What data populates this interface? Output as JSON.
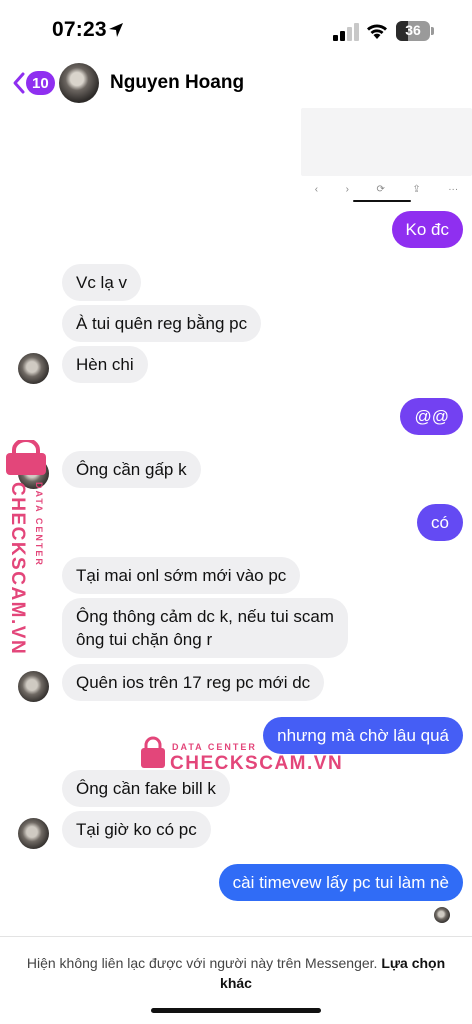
{
  "status_bar": {
    "time": "07:23",
    "battery_text": "36",
    "battery_level_percent": 36,
    "icons": [
      "location-arrow-icon",
      "cellular-signal-icon",
      "wifi-icon",
      "battery-icon"
    ]
  },
  "header": {
    "back_count": "10",
    "contact_name": "Nguyen Hoang",
    "icons": [
      "chevron-left-icon",
      "avatar"
    ]
  },
  "preview": {
    "toolbar_glyphs": [
      "‹",
      "›",
      "⟳",
      "⇪",
      "···"
    ]
  },
  "messages": [
    {
      "side": "out",
      "text": "Ko đc"
    },
    {
      "side": "in",
      "text": "Vc lạ v"
    },
    {
      "side": "in",
      "text": "À tui quên reg bằng pc"
    },
    {
      "side": "in",
      "text": "Hèn chi"
    },
    {
      "side": "out",
      "text": "@@"
    },
    {
      "side": "in",
      "text": "Ông cần gấp k"
    },
    {
      "side": "out",
      "text": "có"
    },
    {
      "side": "in",
      "text": "Tại mai onl sớm mới vào pc"
    },
    {
      "side": "in",
      "text": "Ông thông cảm dc k, nếu tui scam\nông tui chặn ông r"
    },
    {
      "side": "in",
      "text": "Quên ios trên 17 reg pc mới dc"
    },
    {
      "side": "out",
      "text": "nhưng mà chờ lâu quá"
    },
    {
      "side": "in",
      "text": "Ông cần fake bill k"
    },
    {
      "side": "in",
      "text": "Tại giờ ko có pc"
    },
    {
      "side": "out",
      "text": "cài timevew lấy pc tui làm nè"
    }
  ],
  "watermark": {
    "small": "DATA CENTER",
    "big": "CHECKSCAM.VN",
    "color": "#e3467a"
  },
  "footer": {
    "notice": "Hiện không liên lạc được với người này trên Messenger.",
    "link": "Lựa chọn khác"
  },
  "colors": {
    "accent_purple": "#8f2ff0",
    "outgoing_gradient_top": "#8f2ff0",
    "outgoing_gradient_bottom": "#2f6cf6",
    "incoming_bubble": "#efeff1"
  }
}
